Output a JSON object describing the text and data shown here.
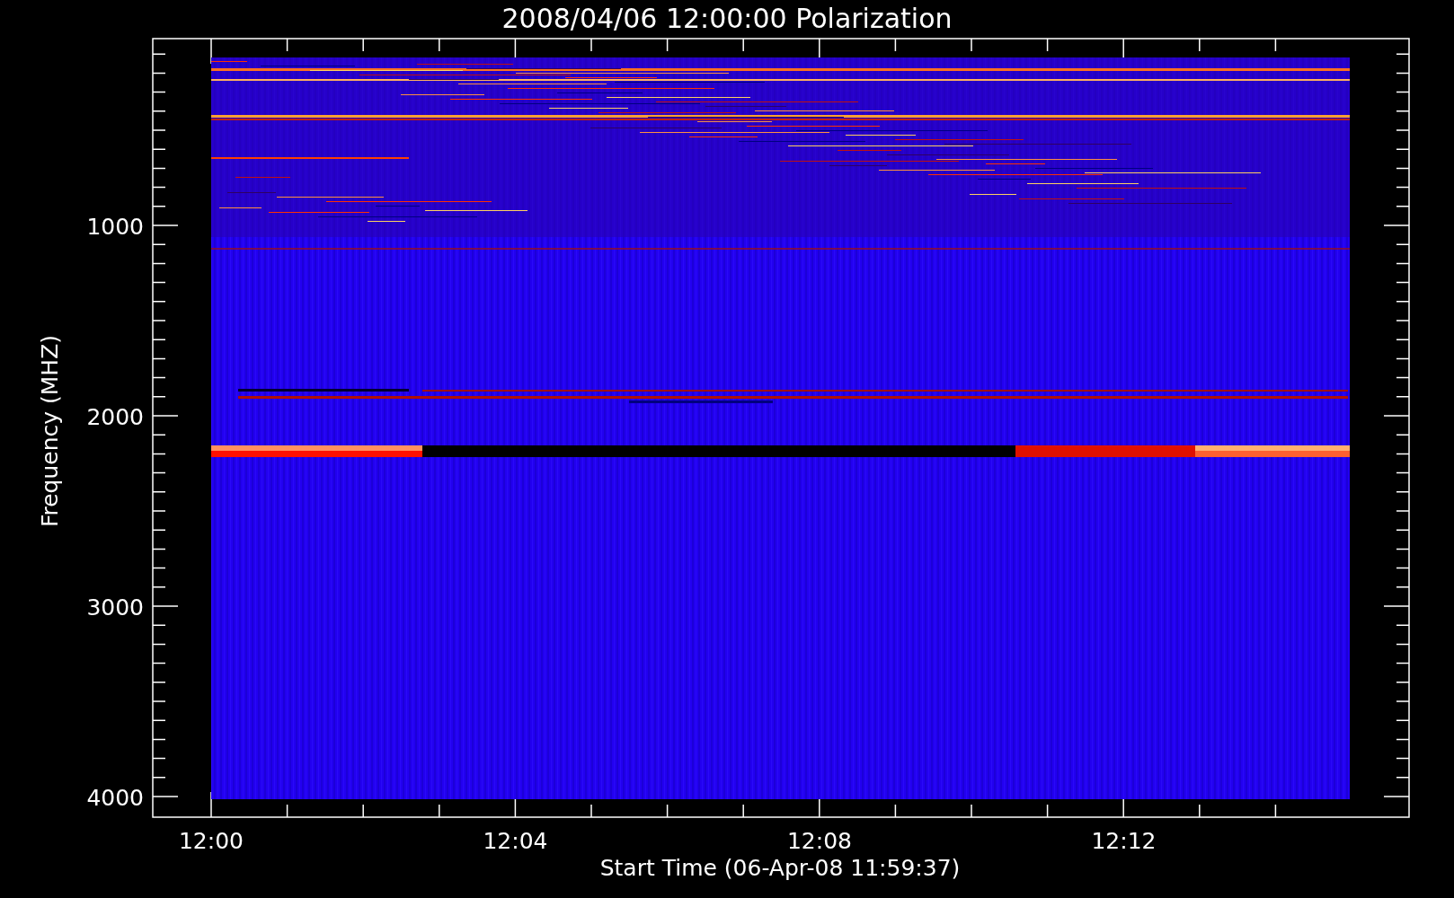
{
  "plot": {
    "title": "2008/04/06 12:00:00 Polarization",
    "xlabel": "Start Time (06-Apr-08 11:59:37)",
    "ylabel": "Frequency (MHZ)",
    "xticks": [
      "12:00",
      "12:04",
      "12:08",
      "12:12"
    ],
    "yticks": [
      "1000",
      "2000",
      "3000",
      "4000"
    ]
  }
}
